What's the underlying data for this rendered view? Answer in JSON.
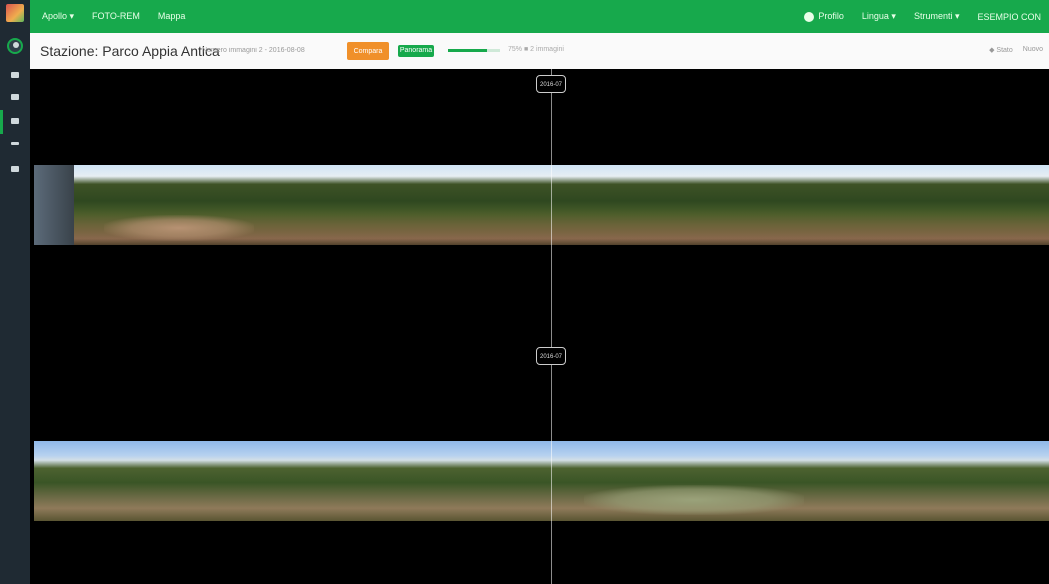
{
  "topbar": {
    "nav_left": [
      "Apollo ▾",
      "FOTO-REM",
      "Mappa"
    ],
    "nav_right": [
      "Profilo",
      "Lingua ▾",
      "Strumenti ▾",
      "ESEMPIO CON"
    ],
    "bg_color": "#17a94c"
  },
  "subbar": {
    "station_title": "Stazione: Parco Appia Antica",
    "meta_text": "Numero immagini 2 - 2016-08-08",
    "orange_button": "Compara",
    "green_badge": "Panorama",
    "progress_value": 0.75,
    "progress_text": "75% ■ 2 immagini",
    "right_items": [
      "◆ Stato",
      "Nuovo"
    ]
  },
  "viewer": {
    "tags": [
      "2016-07",
      "2016-07"
    ]
  },
  "sidebar": {
    "icons": [
      "logo-icon",
      "avatar-icon",
      "arrow-icon",
      "image-icon",
      "print-icon",
      "minus-icon",
      "list-icon"
    ]
  }
}
